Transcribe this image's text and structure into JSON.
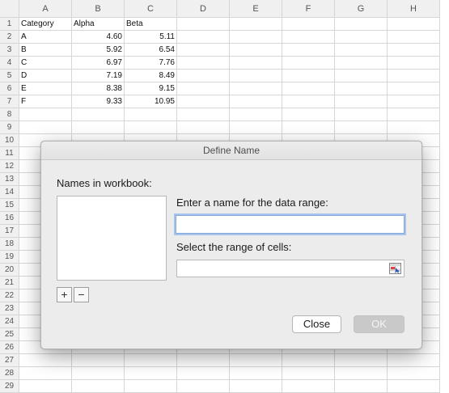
{
  "sheet": {
    "columns": [
      "A",
      "B",
      "C",
      "D",
      "E",
      "F",
      "G",
      "H"
    ],
    "rows": [
      "1",
      "2",
      "3",
      "4",
      "5",
      "6",
      "7",
      "8",
      "9",
      "10",
      "11",
      "12",
      "13",
      "14",
      "15",
      "16",
      "17",
      "18",
      "19",
      "20",
      "21",
      "22",
      "23",
      "24",
      "25",
      "26",
      "27",
      "28",
      "29"
    ],
    "cells": [
      [
        "Category",
        "Alpha",
        "Beta"
      ],
      [
        "A",
        "4.60",
        "5.11"
      ],
      [
        "B",
        "5.92",
        "6.54"
      ],
      [
        "C",
        "6.97",
        "7.76"
      ],
      [
        "D",
        "7.19",
        "8.49"
      ],
      [
        "E",
        "8.38",
        "9.15"
      ],
      [
        "F",
        "9.33",
        "10.95"
      ]
    ]
  },
  "dialog": {
    "title": "Define Name",
    "names_label": "Names in workbook:",
    "name_label": "Enter a name for the data range:",
    "name_value": "",
    "range_label": "Select the range of cells:",
    "range_value": "",
    "add_label": "+",
    "remove_label": "−",
    "close_label": "Close",
    "ok_label": "OK"
  },
  "colors": {
    "focus_ring": "#a6c3ec",
    "ok_disabled": "#c9c9c9"
  }
}
